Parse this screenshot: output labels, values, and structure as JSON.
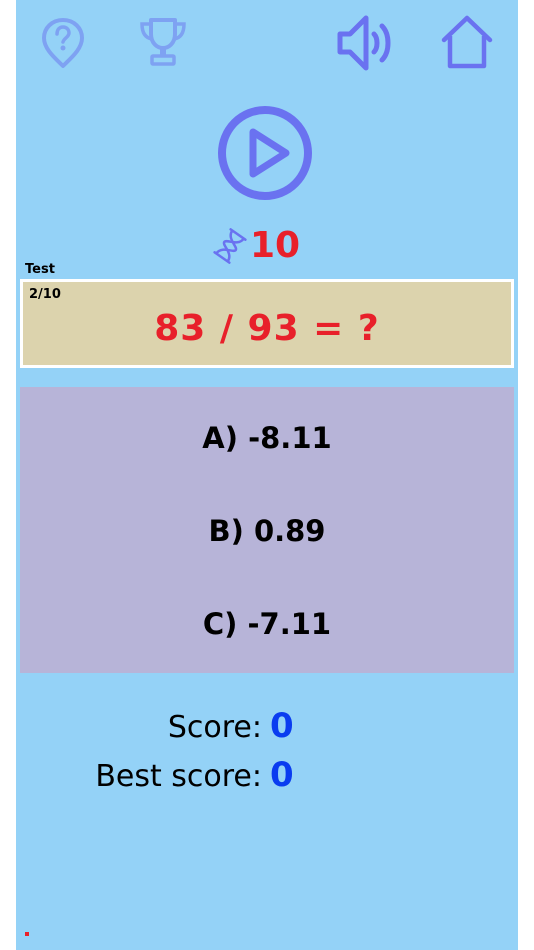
{
  "header": {
    "help_icon": "help-icon",
    "trophy_icon": "trophy-icon",
    "sound_icon": "speaker-icon",
    "home_icon": "home-icon"
  },
  "play_icon": "play-icon",
  "timer": {
    "icon": "hourglass-icon",
    "value": "10"
  },
  "quiz": {
    "mode_label": "Test",
    "progress": "2/10",
    "question": "83 / 93 = ?",
    "answers": [
      "A) -8.11",
      "B) 0.89",
      "C) -7.11"
    ]
  },
  "score": {
    "score_label": "Score:",
    "score_value": "0",
    "best_label": "Best score:",
    "best_value": "0"
  },
  "colors": {
    "background": "#94d2f7",
    "icon": "#6a72f0",
    "accent_red": "#e8202a",
    "question_bg": "#dcd3ad",
    "answers_bg": "#b7b4d8",
    "score_blue": "#0a3cf0"
  }
}
